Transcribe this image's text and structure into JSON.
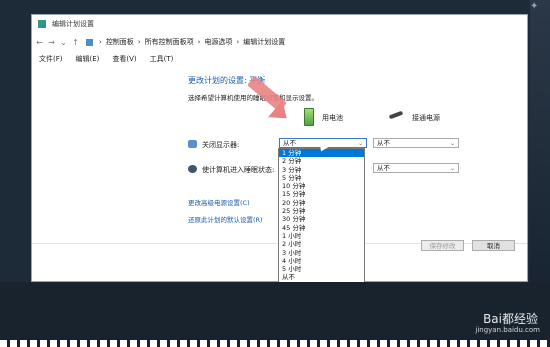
{
  "window": {
    "title": "编辑计划设置"
  },
  "address": {
    "crumbs": [
      "控制面板",
      "所有控制面板项",
      "电源选项",
      "编辑计划设置"
    ],
    "separator": "›"
  },
  "menu": [
    "文件(F)",
    "编辑(E)",
    "查看(V)",
    "工具(T)"
  ],
  "page": {
    "heading": "更改计划的设置: 平衡",
    "subtext": "选择希望计算机使用的睡眠设置和显示设置。",
    "battery_label": "用电池",
    "plugged_label": "接通电源"
  },
  "rows": [
    {
      "label": "关闭显示器:",
      "battery_value": "从不",
      "plugged_value": "从不"
    },
    {
      "label": "使计算机进入睡眠状态:",
      "battery_value": "从不",
      "plugged_value": "从不"
    }
  ],
  "links": [
    "更改高级电源设置(C)",
    "还原此计划的默认设置(R)"
  ],
  "buttons": {
    "save": "保存修改",
    "cancel": "取消"
  },
  "dropdown": {
    "items": [
      "1 分钟",
      "2 分钟",
      "3 分钟",
      "5 分钟",
      "10 分钟",
      "15 分钟",
      "20 分钟",
      "25 分钟",
      "30 分钟",
      "45 分钟",
      "1 小时",
      "2 小时",
      "3 小时",
      "4 小时",
      "5 小时",
      "从不"
    ],
    "selected_index": 0
  },
  "watermark": {
    "main": "Bai都经验",
    "sub": "jingyan.baidu.com"
  },
  "colors": {
    "accent": "#0078d7",
    "link": "#1a5aa8",
    "annotation_arrow": "#e98383"
  }
}
